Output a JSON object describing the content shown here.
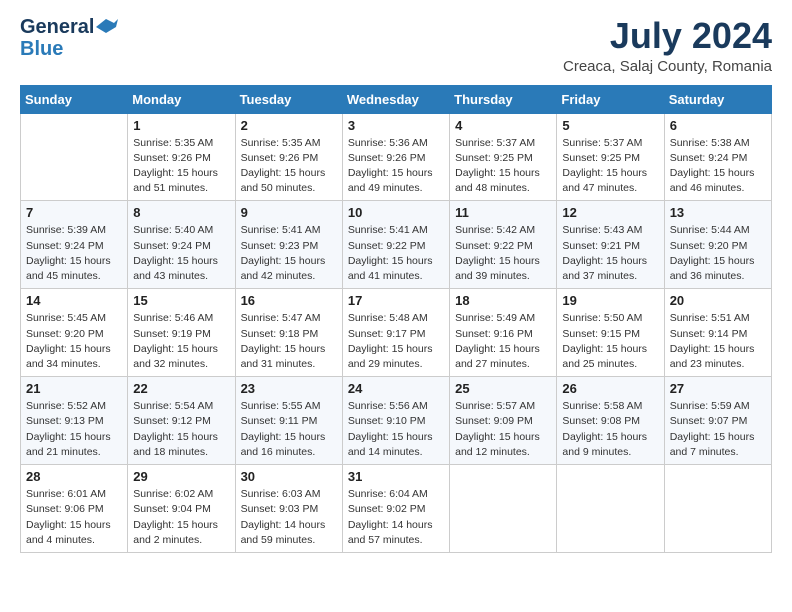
{
  "header": {
    "logo_line1": "General",
    "logo_line2": "Blue",
    "month": "July 2024",
    "location": "Creaca, Salaj County, Romania"
  },
  "days_of_week": [
    "Sunday",
    "Monday",
    "Tuesday",
    "Wednesday",
    "Thursday",
    "Friday",
    "Saturday"
  ],
  "weeks": [
    [
      {
        "day": "",
        "info": ""
      },
      {
        "day": "1",
        "info": "Sunrise: 5:35 AM\nSunset: 9:26 PM\nDaylight: 15 hours\nand 51 minutes."
      },
      {
        "day": "2",
        "info": "Sunrise: 5:35 AM\nSunset: 9:26 PM\nDaylight: 15 hours\nand 50 minutes."
      },
      {
        "day": "3",
        "info": "Sunrise: 5:36 AM\nSunset: 9:26 PM\nDaylight: 15 hours\nand 49 minutes."
      },
      {
        "day": "4",
        "info": "Sunrise: 5:37 AM\nSunset: 9:25 PM\nDaylight: 15 hours\nand 48 minutes."
      },
      {
        "day": "5",
        "info": "Sunrise: 5:37 AM\nSunset: 9:25 PM\nDaylight: 15 hours\nand 47 minutes."
      },
      {
        "day": "6",
        "info": "Sunrise: 5:38 AM\nSunset: 9:24 PM\nDaylight: 15 hours\nand 46 minutes."
      }
    ],
    [
      {
        "day": "7",
        "info": "Sunrise: 5:39 AM\nSunset: 9:24 PM\nDaylight: 15 hours\nand 45 minutes."
      },
      {
        "day": "8",
        "info": "Sunrise: 5:40 AM\nSunset: 9:24 PM\nDaylight: 15 hours\nand 43 minutes."
      },
      {
        "day": "9",
        "info": "Sunrise: 5:41 AM\nSunset: 9:23 PM\nDaylight: 15 hours\nand 42 minutes."
      },
      {
        "day": "10",
        "info": "Sunrise: 5:41 AM\nSunset: 9:22 PM\nDaylight: 15 hours\nand 41 minutes."
      },
      {
        "day": "11",
        "info": "Sunrise: 5:42 AM\nSunset: 9:22 PM\nDaylight: 15 hours\nand 39 minutes."
      },
      {
        "day": "12",
        "info": "Sunrise: 5:43 AM\nSunset: 9:21 PM\nDaylight: 15 hours\nand 37 minutes."
      },
      {
        "day": "13",
        "info": "Sunrise: 5:44 AM\nSunset: 9:20 PM\nDaylight: 15 hours\nand 36 minutes."
      }
    ],
    [
      {
        "day": "14",
        "info": "Sunrise: 5:45 AM\nSunset: 9:20 PM\nDaylight: 15 hours\nand 34 minutes."
      },
      {
        "day": "15",
        "info": "Sunrise: 5:46 AM\nSunset: 9:19 PM\nDaylight: 15 hours\nand 32 minutes."
      },
      {
        "day": "16",
        "info": "Sunrise: 5:47 AM\nSunset: 9:18 PM\nDaylight: 15 hours\nand 31 minutes."
      },
      {
        "day": "17",
        "info": "Sunrise: 5:48 AM\nSunset: 9:17 PM\nDaylight: 15 hours\nand 29 minutes."
      },
      {
        "day": "18",
        "info": "Sunrise: 5:49 AM\nSunset: 9:16 PM\nDaylight: 15 hours\nand 27 minutes."
      },
      {
        "day": "19",
        "info": "Sunrise: 5:50 AM\nSunset: 9:15 PM\nDaylight: 15 hours\nand 25 minutes."
      },
      {
        "day": "20",
        "info": "Sunrise: 5:51 AM\nSunset: 9:14 PM\nDaylight: 15 hours\nand 23 minutes."
      }
    ],
    [
      {
        "day": "21",
        "info": "Sunrise: 5:52 AM\nSunset: 9:13 PM\nDaylight: 15 hours\nand 21 minutes."
      },
      {
        "day": "22",
        "info": "Sunrise: 5:54 AM\nSunset: 9:12 PM\nDaylight: 15 hours\nand 18 minutes."
      },
      {
        "day": "23",
        "info": "Sunrise: 5:55 AM\nSunset: 9:11 PM\nDaylight: 15 hours\nand 16 minutes."
      },
      {
        "day": "24",
        "info": "Sunrise: 5:56 AM\nSunset: 9:10 PM\nDaylight: 15 hours\nand 14 minutes."
      },
      {
        "day": "25",
        "info": "Sunrise: 5:57 AM\nSunset: 9:09 PM\nDaylight: 15 hours\nand 12 minutes."
      },
      {
        "day": "26",
        "info": "Sunrise: 5:58 AM\nSunset: 9:08 PM\nDaylight: 15 hours\nand 9 minutes."
      },
      {
        "day": "27",
        "info": "Sunrise: 5:59 AM\nSunset: 9:07 PM\nDaylight: 15 hours\nand 7 minutes."
      }
    ],
    [
      {
        "day": "28",
        "info": "Sunrise: 6:01 AM\nSunset: 9:06 PM\nDaylight: 15 hours\nand 4 minutes."
      },
      {
        "day": "29",
        "info": "Sunrise: 6:02 AM\nSunset: 9:04 PM\nDaylight: 15 hours\nand 2 minutes."
      },
      {
        "day": "30",
        "info": "Sunrise: 6:03 AM\nSunset: 9:03 PM\nDaylight: 14 hours\nand 59 minutes."
      },
      {
        "day": "31",
        "info": "Sunrise: 6:04 AM\nSunset: 9:02 PM\nDaylight: 14 hours\nand 57 minutes."
      },
      {
        "day": "",
        "info": ""
      },
      {
        "day": "",
        "info": ""
      },
      {
        "day": "",
        "info": ""
      }
    ]
  ]
}
